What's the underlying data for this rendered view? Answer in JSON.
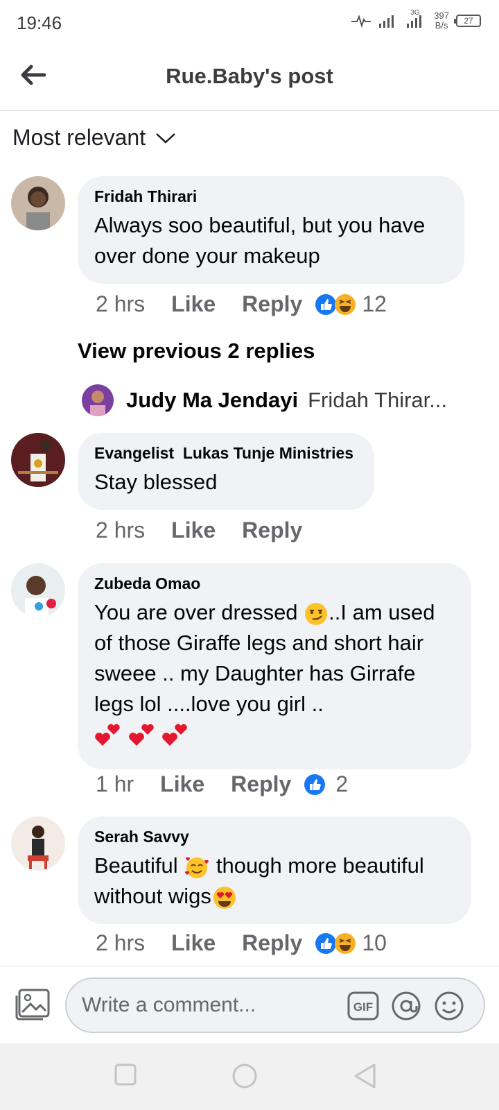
{
  "status_bar": {
    "time": "19:46",
    "speed_value": "397",
    "speed_unit": "B/s",
    "network": "3G",
    "battery": "27"
  },
  "header": {
    "title": "Rue.Baby's post"
  },
  "sort": {
    "label": "Most relevant"
  },
  "comments": [
    {
      "author": "Fridah Thirari",
      "text": "Always soo beautiful, but you have over done your makeup",
      "time": "2 hrs",
      "like": "Like",
      "reply": "Reply",
      "reactions": [
        "like-reaction-icon",
        "haha-reaction-icon"
      ],
      "reaction_count": "12"
    },
    {
      "author": "Evangelist  Lukas Tunje Ministries",
      "text": "Stay blessed",
      "time": "2 hrs",
      "like": "Like",
      "reply": "Reply"
    },
    {
      "author": "Zubeda Omao",
      "text_part1": "You are over dressed ",
      "text_part2": "..I am used of those Giraffe legs and short hair sweee .. my Daughter has Girrafe legs lol ....love you girl ..",
      "time": "1 hr",
      "like": "Like",
      "reply": "Reply",
      "reactions": [
        "like-reaction-icon"
      ],
      "reaction_count": "2"
    },
    {
      "author": "Serah Savvy",
      "text_part1": "Beautiful ",
      "text_part2": " though more beautiful without wigs",
      "time": "2 hrs",
      "like": "Like",
      "reply": "Reply",
      "reactions": [
        "like-reaction-icon",
        "haha-reaction-icon"
      ],
      "reaction_count": "10"
    }
  ],
  "replies_thread": {
    "view_previous": "View previous 2 replies",
    "reply_author": "Judy Ma Jendayi",
    "reply_snippet": "Fridah Thirar..."
  },
  "composer": {
    "placeholder": "Write a comment...",
    "gif_label": "GIF"
  },
  "colors": {
    "bubble": "#f0f2f5",
    "secondary_text": "#65676b",
    "like_blue": "#1877f2",
    "haha_yellow": "#f7b125"
  }
}
